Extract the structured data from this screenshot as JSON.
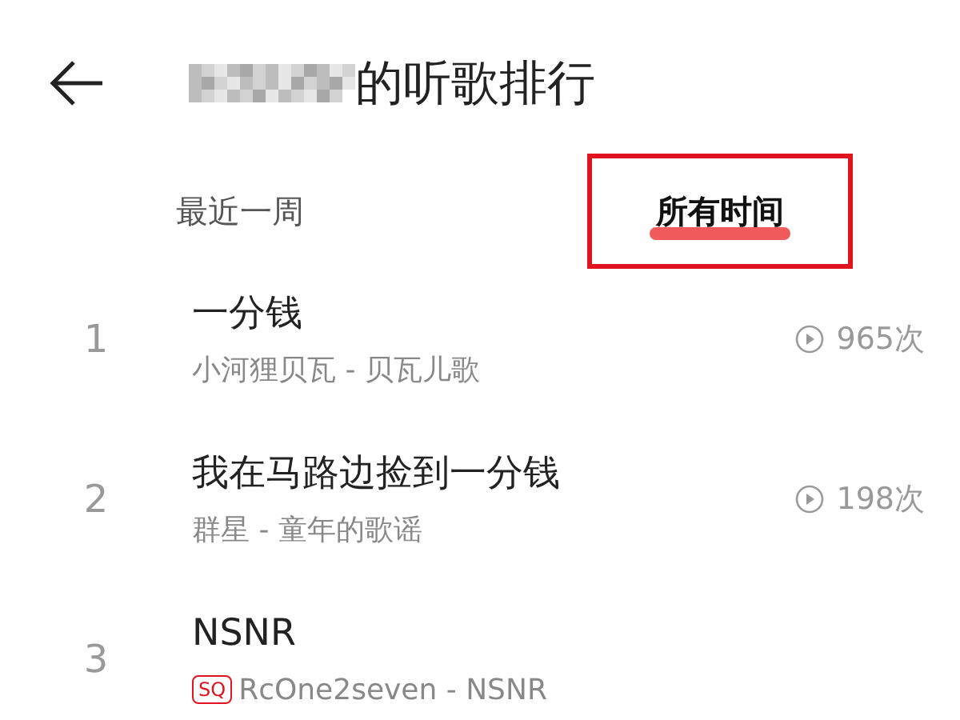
{
  "header": {
    "title": "的听歌排行",
    "name_blurred": true
  },
  "tabs": [
    {
      "label": "最近一周",
      "selected": false,
      "highlighted": false
    },
    {
      "label": "所有时间",
      "selected": true,
      "highlighted": true
    }
  ],
  "songs": [
    {
      "rank": "1",
      "title": "一分钱",
      "subtitle": "小河狸贝瓦 - 贝瓦儿歌",
      "plays": "965次",
      "sq": false
    },
    {
      "rank": "2",
      "title": "我在马路边捡到一分钱",
      "subtitle": "群星 - 童年的歌谣",
      "plays": "198次",
      "sq": false
    },
    {
      "rank": "3",
      "title": "NSNR",
      "subtitle": "RcOne2seven - NSNR",
      "sq": true,
      "sq_label": "SQ"
    }
  ]
}
